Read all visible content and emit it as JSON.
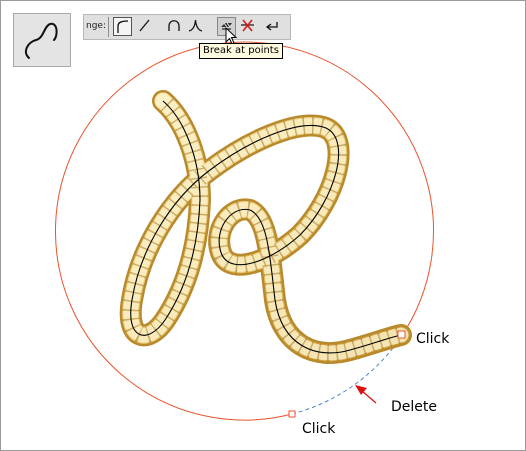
{
  "toolbar": {
    "label": "nge:",
    "tooltip": "Break at points",
    "buttons": [
      {
        "name": "smooth-join-button",
        "icon": "smooth-curve-icon"
      },
      {
        "name": "make-line-button",
        "icon": "straight-line-icon"
      },
      {
        "name": "make-smooth-button",
        "icon": "smooth-point-icon"
      },
      {
        "name": "make-cusp-button",
        "icon": "cusp-point-icon"
      },
      {
        "name": "break-at-points-button",
        "icon": "break-at-points-icon"
      },
      {
        "name": "delete-points-button",
        "icon": "delete-point-icon"
      },
      {
        "name": "reverse-path-button",
        "icon": "reverse-path-icon"
      }
    ]
  },
  "callouts": {
    "click_top": "Click",
    "delete": "Delete",
    "click_bottom": "Click"
  },
  "colors": {
    "circle": "#e8552e",
    "dashed_segment": "#4f86c6",
    "arrow": "#dd1111",
    "rope_light": "#f7e6a6",
    "rope_mid": "#e2bd62",
    "rope_dark": "#bf8f2a",
    "path": "#000000",
    "node_fill": "#ffffff",
    "node_stroke": "#e8552e"
  }
}
